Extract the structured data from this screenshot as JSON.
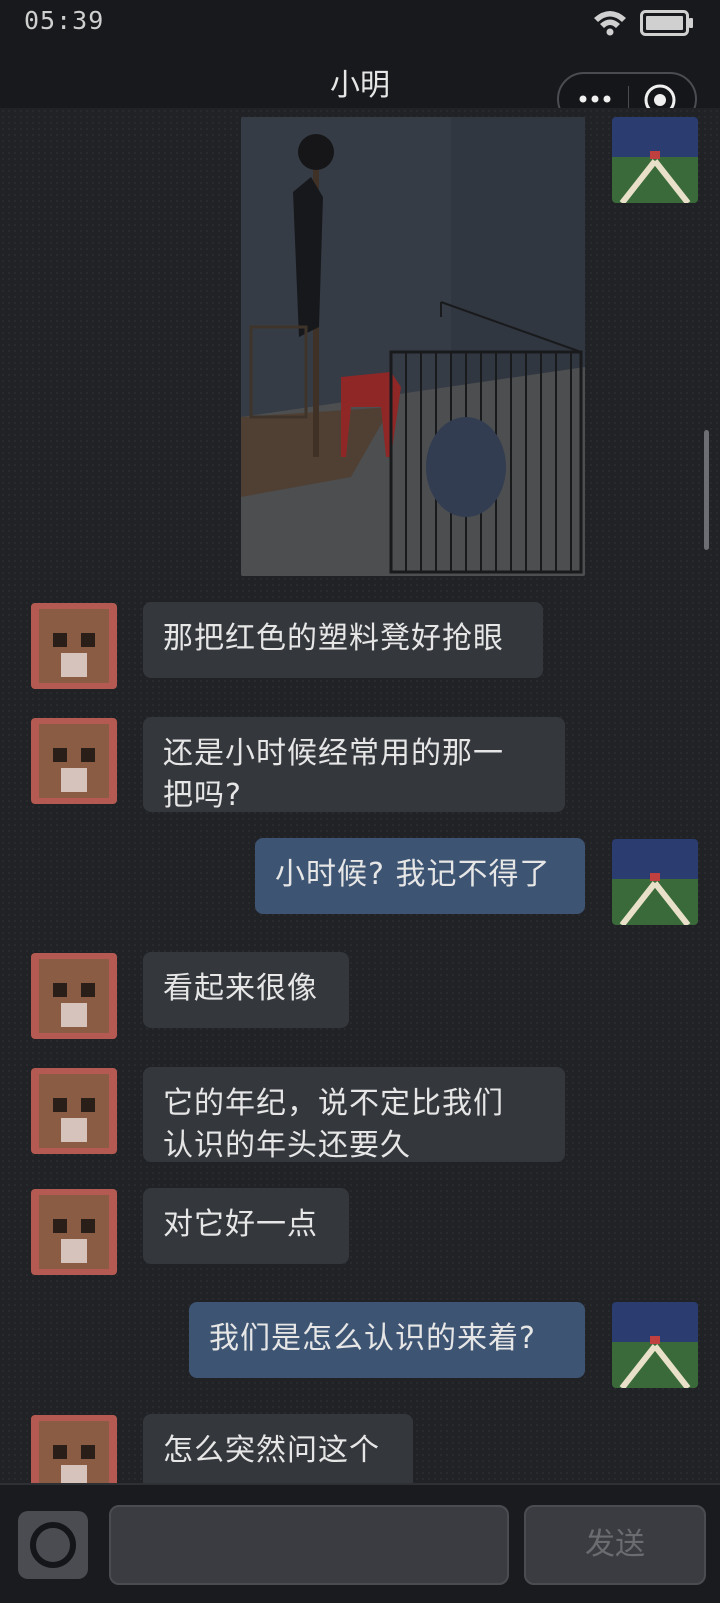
{
  "status_bar": {
    "time": "05:39"
  },
  "header": {
    "title": "小明"
  },
  "capsule": {
    "more_icon": "more-dots-icon",
    "target_icon": "target-icon"
  },
  "messages": [
    {
      "from": "self",
      "type": "image"
    },
    {
      "from": "other",
      "text": "那把红色的塑料凳好抢眼"
    },
    {
      "from": "other",
      "text": "还是小时候经常用的那一\n把吗?"
    },
    {
      "from": "self",
      "text": "小时候? 我记不得了"
    },
    {
      "from": "other",
      "text": "看起来很像"
    },
    {
      "from": "other",
      "text": "它的年纪，说不定比我们\n认识的年头还要久"
    },
    {
      "from": "other",
      "text": "对它好一点"
    },
    {
      "from": "self",
      "text": "我们是怎么认识的来着?"
    },
    {
      "from": "other",
      "text": "怎么突然问这个"
    }
  ],
  "input_bar": {
    "send_label": "发送",
    "input_value": "",
    "camera_icon": "camera-icon"
  },
  "colors": {
    "self_bubble": "#3e5473",
    "other_bubble": "#34373c",
    "background": "#212327"
  }
}
